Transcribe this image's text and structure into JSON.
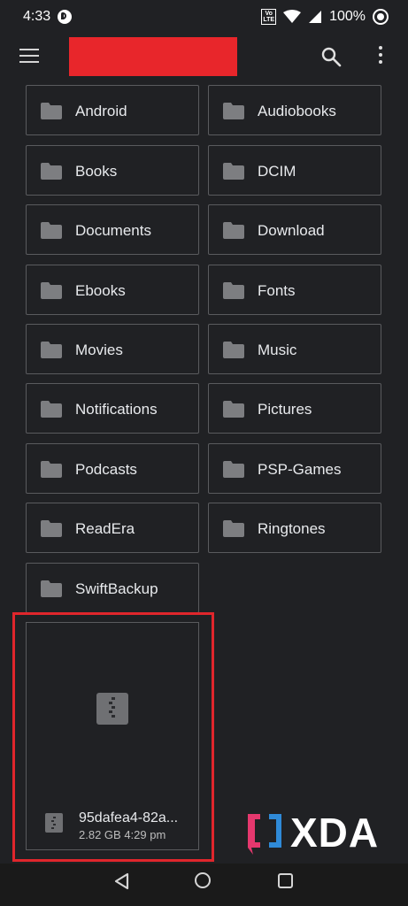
{
  "status_bar": {
    "time": "4:33",
    "volte": "Vo LTE",
    "battery": "100%"
  },
  "app_bar": {
    "menu_icon": "menu-icon",
    "search_icon": "search-icon",
    "more_icon": "more-vert-icon"
  },
  "folders": [
    {
      "label": "Android"
    },
    {
      "label": "Audiobooks"
    },
    {
      "label": "Books"
    },
    {
      "label": "DCIM"
    },
    {
      "label": "Documents"
    },
    {
      "label": "Download"
    },
    {
      "label": "Ebooks"
    },
    {
      "label": "Fonts"
    },
    {
      "label": "Movies"
    },
    {
      "label": "Music"
    },
    {
      "label": "Notifications"
    },
    {
      "label": "Pictures"
    },
    {
      "label": "Podcasts"
    },
    {
      "label": "PSP-Games"
    },
    {
      "label": "ReadEra"
    },
    {
      "label": "Ringtones"
    },
    {
      "label": "SwiftBackup"
    }
  ],
  "file": {
    "name": "95dafea4-82a...",
    "size": "2.82 GB",
    "time": "4:29 pm",
    "icon": "zip-file-icon"
  },
  "watermark": {
    "text": "XDA"
  },
  "colors": {
    "background": "#202124",
    "highlight": "#e0262c",
    "redaction": "#e8262b",
    "watermark_accent_pink": "#e5386e",
    "watermark_accent_blue": "#2f8ad8"
  }
}
